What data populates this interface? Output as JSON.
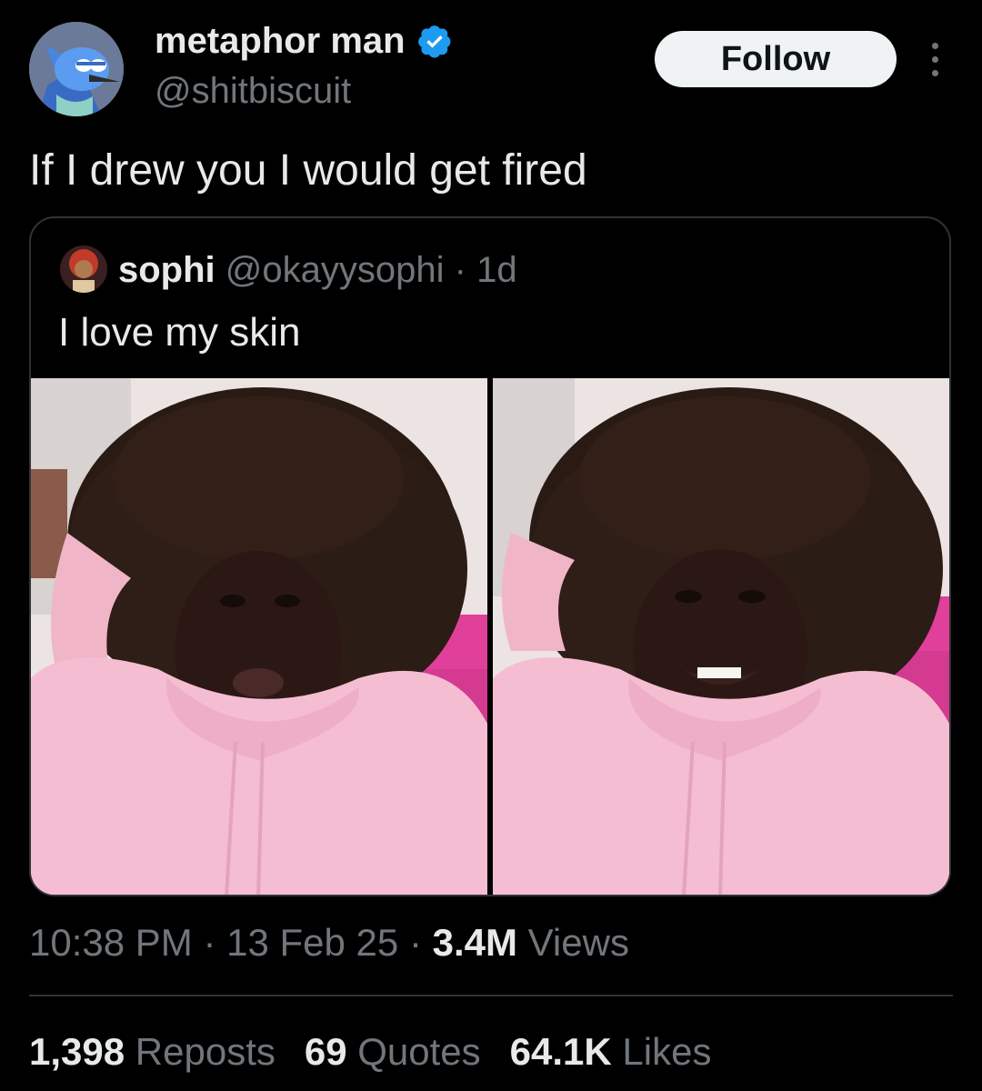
{
  "author": {
    "display_name": "metaphor man",
    "handle": "@shitbiscuit",
    "verified_icon": "verified-badge-icon",
    "avatar_icon": "cartoon-bird-avatar"
  },
  "actions": {
    "follow_label": "Follow",
    "more_icon": "more-vertical-icon"
  },
  "tweet": {
    "text": "If I drew you I would get fired"
  },
  "quoted": {
    "display_name": "sophi",
    "handle": "@okayysophi",
    "separator": "·",
    "time": "1d",
    "text": "I love my skin",
    "photos": [
      "selfie-pouting",
      "selfie-smiling"
    ]
  },
  "meta": {
    "time": "10:38 PM",
    "sep1": "·",
    "date": "13 Feb 25",
    "sep2": "·",
    "views_count": "3.4M",
    "views_label": "Views"
  },
  "stats": {
    "reposts_count": "1,398",
    "reposts_label": "Reposts",
    "quotes_count": "69",
    "quotes_label": "Quotes",
    "likes_count": "64.1K",
    "likes_label": "Likes"
  },
  "colors": {
    "background": "#000000",
    "primary_text": "#e7e9ea",
    "secondary_text": "#71767b",
    "verified_blue": "#1d9bf0",
    "border": "#2f3336"
  }
}
